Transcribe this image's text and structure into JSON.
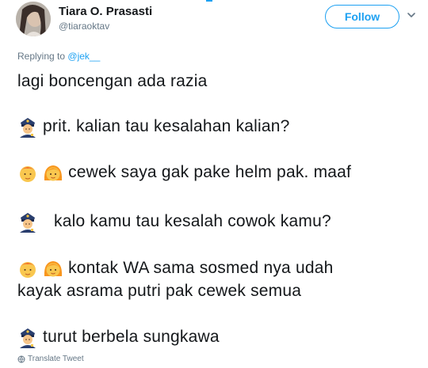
{
  "user": {
    "display_name": "Tiara O. Prasasti",
    "handle": "@tiaraoktav"
  },
  "follow_label": "Follow",
  "reply": {
    "prefix": "Replying to",
    "mention": "@jek__"
  },
  "tweet": {
    "lines": [
      {
        "emoji": [],
        "text": "lagi boncengan ada razia"
      },
      {
        "emoji": [
          "police-officer"
        ],
        "text": "prit. kalian tau kesalahan kalian?"
      },
      {
        "emoji": [
          "boy",
          "girl"
        ],
        "text": "cewek saya gak pake helm pak. maaf"
      },
      {
        "emoji": [
          "police-officer"
        ],
        "text": "kalo kamu tau kesalah cowok kamu?"
      },
      {
        "emoji": [
          "boy",
          "girl"
        ],
        "text": "kontak WA sama sosmed nya udah"
      },
      {
        "emoji": [],
        "text": "kayak asrama putri pak cewek semua"
      },
      {
        "emoji": [
          "police-officer"
        ],
        "text": "turut berbela sungkawa"
      }
    ]
  },
  "translate_label": "Translate Tweet",
  "colors": {
    "accent": "#1da1f2",
    "muted": "#657786",
    "text": "#14171a"
  }
}
